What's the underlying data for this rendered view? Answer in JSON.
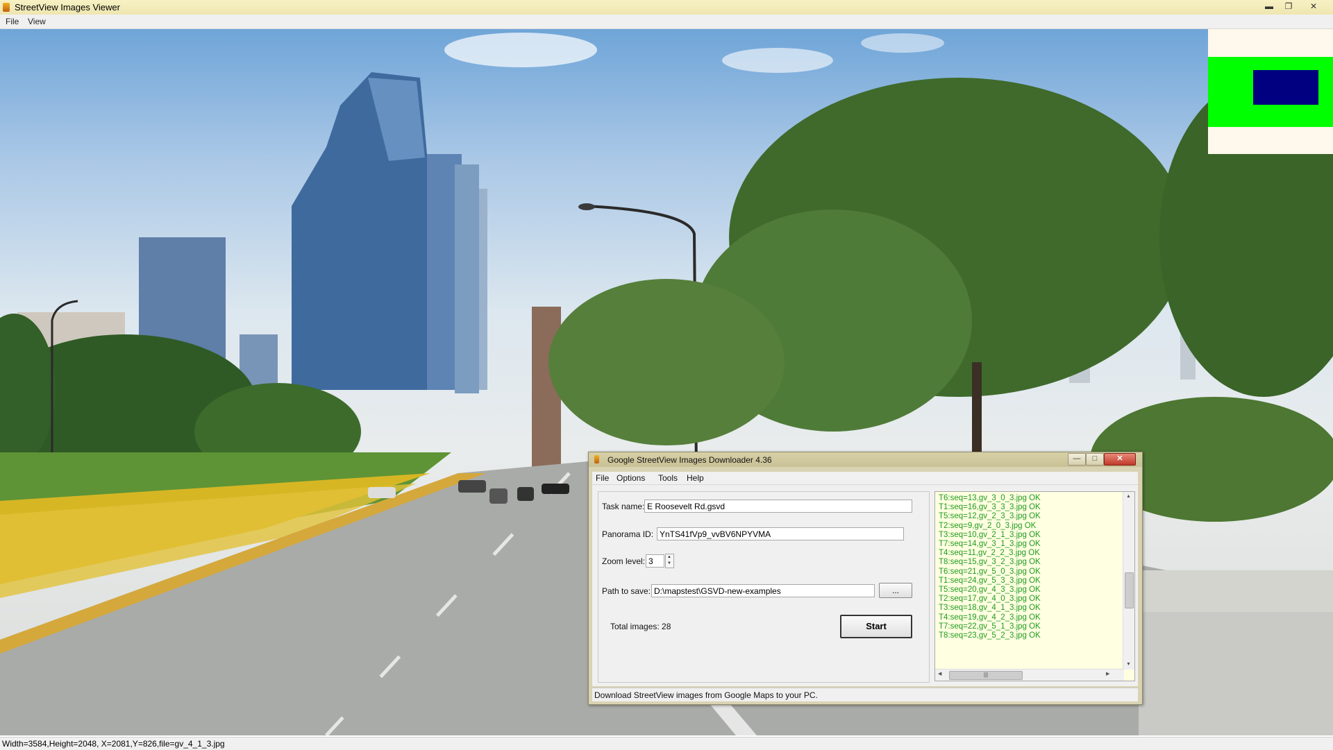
{
  "viewer": {
    "title": "StreetView Images Viewer",
    "menu": [
      "File",
      "View"
    ],
    "window_controls": [
      "minimize",
      "restore",
      "close"
    ],
    "status": "Width=3584,Height=2048, X=2081,Y=826,file=gv_4_1_3.jpg",
    "minimap_colors": {
      "background": "#fff8ec",
      "area": "#00ff00",
      "viewport": "#000080"
    }
  },
  "dialog": {
    "title": "Google StreetView Images Downloader 4.36",
    "menu": [
      "File",
      "Options",
      "Tools",
      "Help"
    ],
    "fields": {
      "task_name_label": "Task name:",
      "task_name_value": "E Roosevelt Rd.gsvd",
      "panorama_id_label": "Panorama ID:",
      "panorama_id_value": "YnTS41fVp9_vvBV6NPYVMA",
      "zoom_label": "Zoom level:",
      "zoom_value": "3",
      "path_label": "Path to save:",
      "path_value": "D:\\mapstest\\GSVD-new-examples",
      "browse_label": "...",
      "total_label": "Total images: 28",
      "start_label": "Start"
    },
    "log": [
      "T6:seq=13,gv_3_0_3.jpg OK",
      "T1:seq=16,gv_3_3_3.jpg OK",
      "T5:seq=12,gv_2_3_3.jpg OK",
      "T2:seq=9,gv_2_0_3.jpg OK",
      "T3:seq=10,gv_2_1_3.jpg OK",
      "T7:seq=14,gv_3_1_3.jpg OK",
      "T4:seq=11,gv_2_2_3.jpg OK",
      "T8:seq=15,gv_3_2_3.jpg OK",
      "T6:seq=21,gv_5_0_3.jpg OK",
      "T1:seq=24,gv_5_3_3.jpg OK",
      "T5:seq=20,gv_4_3_3.jpg OK",
      "T2:seq=17,gv_4_0_3.jpg OK",
      "T3:seq=18,gv_4_1_3.jpg OK",
      "T4:seq=19,gv_4_2_3.jpg OK",
      "T7:seq=22,gv_5_1_3.jpg OK",
      "T8:seq=23,gv_5_2_3.jpg OK"
    ],
    "log_color": "#1f9b1f",
    "status": "Download StreetView images from Google Maps to your PC."
  }
}
